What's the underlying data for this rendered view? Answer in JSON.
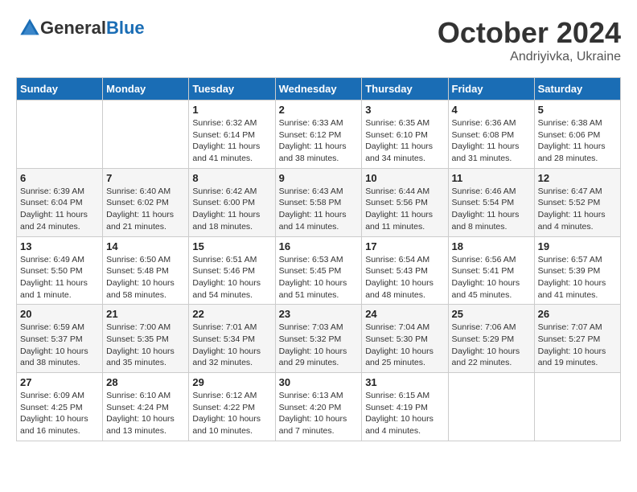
{
  "header": {
    "logo": {
      "text_general": "General",
      "text_blue": "Blue"
    },
    "month": "October 2024",
    "location": "Andriyivka, Ukraine"
  },
  "weekdays": [
    "Sunday",
    "Monday",
    "Tuesday",
    "Wednesday",
    "Thursday",
    "Friday",
    "Saturday"
  ],
  "weeks": [
    [
      null,
      null,
      {
        "day": "1",
        "sunrise": "Sunrise: 6:32 AM",
        "sunset": "Sunset: 6:14 PM",
        "daylight": "Daylight: 11 hours and 41 minutes."
      },
      {
        "day": "2",
        "sunrise": "Sunrise: 6:33 AM",
        "sunset": "Sunset: 6:12 PM",
        "daylight": "Daylight: 11 hours and 38 minutes."
      },
      {
        "day": "3",
        "sunrise": "Sunrise: 6:35 AM",
        "sunset": "Sunset: 6:10 PM",
        "daylight": "Daylight: 11 hours and 34 minutes."
      },
      {
        "day": "4",
        "sunrise": "Sunrise: 6:36 AM",
        "sunset": "Sunset: 6:08 PM",
        "daylight": "Daylight: 11 hours and 31 minutes."
      },
      {
        "day": "5",
        "sunrise": "Sunrise: 6:38 AM",
        "sunset": "Sunset: 6:06 PM",
        "daylight": "Daylight: 11 hours and 28 minutes."
      }
    ],
    [
      {
        "day": "6",
        "sunrise": "Sunrise: 6:39 AM",
        "sunset": "Sunset: 6:04 PM",
        "daylight": "Daylight: 11 hours and 24 minutes."
      },
      {
        "day": "7",
        "sunrise": "Sunrise: 6:40 AM",
        "sunset": "Sunset: 6:02 PM",
        "daylight": "Daylight: 11 hours and 21 minutes."
      },
      {
        "day": "8",
        "sunrise": "Sunrise: 6:42 AM",
        "sunset": "Sunset: 6:00 PM",
        "daylight": "Daylight: 11 hours and 18 minutes."
      },
      {
        "day": "9",
        "sunrise": "Sunrise: 6:43 AM",
        "sunset": "Sunset: 5:58 PM",
        "daylight": "Daylight: 11 hours and 14 minutes."
      },
      {
        "day": "10",
        "sunrise": "Sunrise: 6:44 AM",
        "sunset": "Sunset: 5:56 PM",
        "daylight": "Daylight: 11 hours and 11 minutes."
      },
      {
        "day": "11",
        "sunrise": "Sunrise: 6:46 AM",
        "sunset": "Sunset: 5:54 PM",
        "daylight": "Daylight: 11 hours and 8 minutes."
      },
      {
        "day": "12",
        "sunrise": "Sunrise: 6:47 AM",
        "sunset": "Sunset: 5:52 PM",
        "daylight": "Daylight: 11 hours and 4 minutes."
      }
    ],
    [
      {
        "day": "13",
        "sunrise": "Sunrise: 6:49 AM",
        "sunset": "Sunset: 5:50 PM",
        "daylight": "Daylight: 11 hours and 1 minute."
      },
      {
        "day": "14",
        "sunrise": "Sunrise: 6:50 AM",
        "sunset": "Sunset: 5:48 PM",
        "daylight": "Daylight: 10 hours and 58 minutes."
      },
      {
        "day": "15",
        "sunrise": "Sunrise: 6:51 AM",
        "sunset": "Sunset: 5:46 PM",
        "daylight": "Daylight: 10 hours and 54 minutes."
      },
      {
        "day": "16",
        "sunrise": "Sunrise: 6:53 AM",
        "sunset": "Sunset: 5:45 PM",
        "daylight": "Daylight: 10 hours and 51 minutes."
      },
      {
        "day": "17",
        "sunrise": "Sunrise: 6:54 AM",
        "sunset": "Sunset: 5:43 PM",
        "daylight": "Daylight: 10 hours and 48 minutes."
      },
      {
        "day": "18",
        "sunrise": "Sunrise: 6:56 AM",
        "sunset": "Sunset: 5:41 PM",
        "daylight": "Daylight: 10 hours and 45 minutes."
      },
      {
        "day": "19",
        "sunrise": "Sunrise: 6:57 AM",
        "sunset": "Sunset: 5:39 PM",
        "daylight": "Daylight: 10 hours and 41 minutes."
      }
    ],
    [
      {
        "day": "20",
        "sunrise": "Sunrise: 6:59 AM",
        "sunset": "Sunset: 5:37 PM",
        "daylight": "Daylight: 10 hours and 38 minutes."
      },
      {
        "day": "21",
        "sunrise": "Sunrise: 7:00 AM",
        "sunset": "Sunset: 5:35 PM",
        "daylight": "Daylight: 10 hours and 35 minutes."
      },
      {
        "day": "22",
        "sunrise": "Sunrise: 7:01 AM",
        "sunset": "Sunset: 5:34 PM",
        "daylight": "Daylight: 10 hours and 32 minutes."
      },
      {
        "day": "23",
        "sunrise": "Sunrise: 7:03 AM",
        "sunset": "Sunset: 5:32 PM",
        "daylight": "Daylight: 10 hours and 29 minutes."
      },
      {
        "day": "24",
        "sunrise": "Sunrise: 7:04 AM",
        "sunset": "Sunset: 5:30 PM",
        "daylight": "Daylight: 10 hours and 25 minutes."
      },
      {
        "day": "25",
        "sunrise": "Sunrise: 7:06 AM",
        "sunset": "Sunset: 5:29 PM",
        "daylight": "Daylight: 10 hours and 22 minutes."
      },
      {
        "day": "26",
        "sunrise": "Sunrise: 7:07 AM",
        "sunset": "Sunset: 5:27 PM",
        "daylight": "Daylight: 10 hours and 19 minutes."
      }
    ],
    [
      {
        "day": "27",
        "sunrise": "Sunrise: 6:09 AM",
        "sunset": "Sunset: 4:25 PM",
        "daylight": "Daylight: 10 hours and 16 minutes."
      },
      {
        "day": "28",
        "sunrise": "Sunrise: 6:10 AM",
        "sunset": "Sunset: 4:24 PM",
        "daylight": "Daylight: 10 hours and 13 minutes."
      },
      {
        "day": "29",
        "sunrise": "Sunrise: 6:12 AM",
        "sunset": "Sunset: 4:22 PM",
        "daylight": "Daylight: 10 hours and 10 minutes."
      },
      {
        "day": "30",
        "sunrise": "Sunrise: 6:13 AM",
        "sunset": "Sunset: 4:20 PM",
        "daylight": "Daylight: 10 hours and 7 minutes."
      },
      {
        "day": "31",
        "sunrise": "Sunrise: 6:15 AM",
        "sunset": "Sunset: 4:19 PM",
        "daylight": "Daylight: 10 hours and 4 minutes."
      },
      null,
      null
    ]
  ]
}
